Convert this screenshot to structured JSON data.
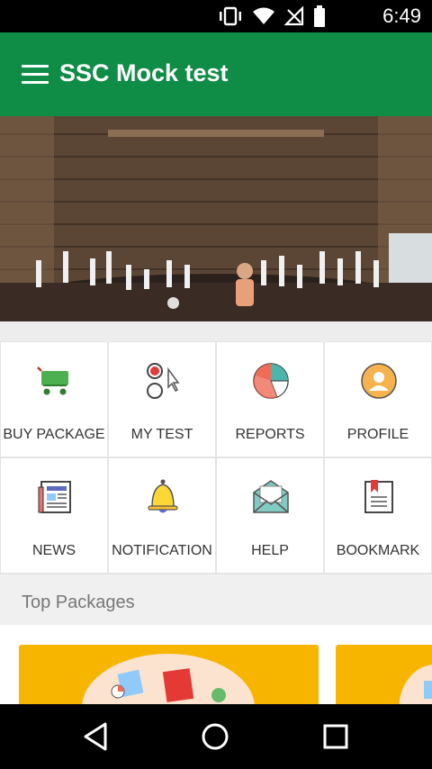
{
  "status_bar": {
    "time": "6:49",
    "icons": [
      "vibrate-icon",
      "wifi-icon",
      "no-signal-icon",
      "battery-icon"
    ]
  },
  "app_bar": {
    "title": "SSC Mock test",
    "color": "#0f8c45",
    "menu_icon": "hamburger-menu-icon"
  },
  "banner": {
    "image": "classroom-photo",
    "pager": {
      "count": 1,
      "active": 0
    }
  },
  "menu": {
    "tiles": [
      {
        "label": "BUY PACKAGE",
        "icon": "cart-icon"
      },
      {
        "label": "MY TEST",
        "icon": "radio-test-icon"
      },
      {
        "label": "REPORTS",
        "icon": "pie-chart-icon"
      },
      {
        "label": "PROFILE",
        "icon": "profile-icon"
      },
      {
        "label": "NEWS",
        "icon": "newspaper-icon"
      },
      {
        "label": "NOTIFICATION",
        "icon": "bell-icon"
      },
      {
        "label": "HELP",
        "icon": "envelope-icon"
      },
      {
        "label": "BOOKMARK",
        "icon": "bookmark-icon"
      }
    ]
  },
  "top_packages": {
    "title": "Top Packages",
    "card_color": "#f7b500"
  },
  "nav_bar": {
    "buttons": [
      "back-icon",
      "home-icon",
      "recents-icon"
    ]
  }
}
